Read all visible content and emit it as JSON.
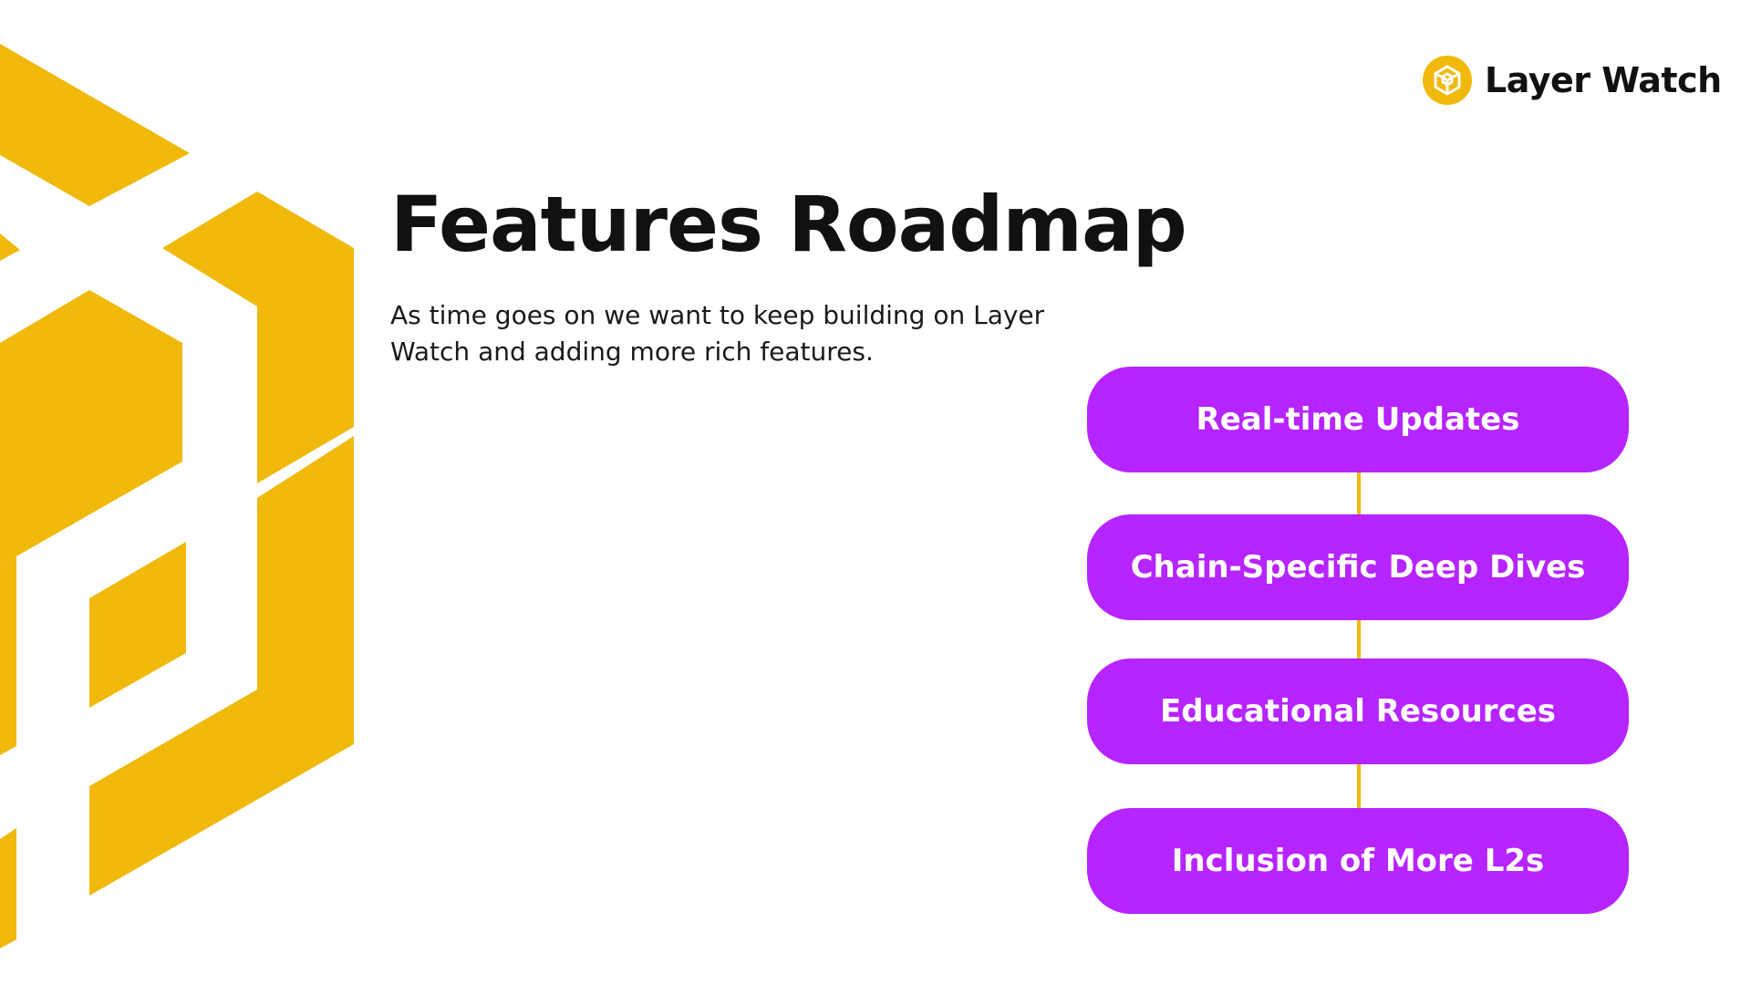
{
  "brand": {
    "name": "Layer Watch",
    "icon": "cube-logo-icon",
    "accent_color": "#f0b90b"
  },
  "slide": {
    "title": "Features Roadmap",
    "subtitle": "As time goes on we want to keep building on Layer Watch and adding more rich features."
  },
  "roadmap": {
    "pill_color": "#b624ff",
    "connector_color": "#f0b90b",
    "items": [
      {
        "label": "Real-time Updates"
      },
      {
        "label": "Chain-Specific Deep Dives"
      },
      {
        "label": "Educational Resources"
      },
      {
        "label": "Inclusion of More L2s"
      }
    ]
  },
  "decoration": {
    "icon": "isometric-cube-pattern-icon",
    "color": "#f0b90b"
  }
}
